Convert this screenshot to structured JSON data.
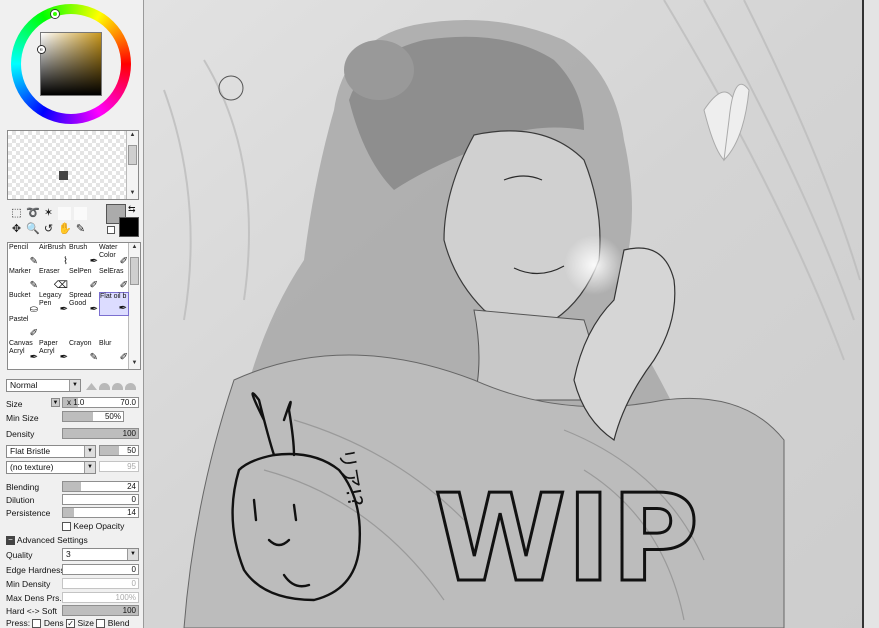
{
  "colors": {
    "accent_selection": "#7b6fd0",
    "fg_color": "#ababab",
    "bg_color": "#000000",
    "sv_hue": "#c8971d"
  },
  "brushes": [
    {
      "label": "Pencil",
      "icon": "pencil-icon"
    },
    {
      "label": "AirBrush",
      "icon": "airbrush-icon"
    },
    {
      "label": "Brush",
      "icon": "brush-icon"
    },
    {
      "label": "Water Color",
      "icon": "watercolor-icon"
    },
    {
      "label": "Marker",
      "icon": "marker-icon"
    },
    {
      "label": "Eraser",
      "icon": "eraser-icon"
    },
    {
      "label": "SelPen",
      "icon": "selpen-icon"
    },
    {
      "label": "SelEras",
      "icon": "seleras-icon"
    },
    {
      "label": "Bucket",
      "icon": "bucket-icon"
    },
    {
      "label": "Legacy Pen",
      "icon": "legacy-pen-icon"
    },
    {
      "label": "Spread Good",
      "icon": "spread-icon"
    },
    {
      "label": "Flat oil b",
      "icon": "flat-oil-icon",
      "selected": true
    },
    {
      "label": "Pastel",
      "icon": "pastel-icon"
    },
    {
      "label": "",
      "icon": ""
    },
    {
      "label": "",
      "icon": ""
    },
    {
      "label": "",
      "icon": ""
    },
    {
      "label": "Canvas Acryl",
      "icon": "canvas-acryl-icon"
    },
    {
      "label": "Paper Acryl",
      "icon": "paper-acryl-icon"
    },
    {
      "label": "Crayon",
      "icon": "crayon-icon"
    },
    {
      "label": "Blur",
      "icon": "blur-icon"
    }
  ],
  "settings": {
    "blend_mode": "Normal",
    "size_label": "Size",
    "size_mult": "x 1.0",
    "size_value": "70.0",
    "size_fraction": 0.2,
    "min_size_label": "Min Size",
    "min_size_value": "50%",
    "min_size_fraction": 0.5,
    "density_label": "Density",
    "density_value": "100",
    "density_fraction": 1.0,
    "brush_shape": "Flat Bristle",
    "brush_shape_value": "50",
    "brush_shape_fraction": 0.5,
    "texture": "(no texture)",
    "texture_value": "95",
    "blending_label": "Blending",
    "blending_value": "24",
    "blending_fraction": 0.24,
    "dilution_label": "Dilution",
    "dilution_value": "0",
    "dilution_fraction": 0,
    "persistence_label": "Persistence",
    "persistence_value": "14",
    "persistence_fraction": 0.14,
    "keep_opacity_label": "Keep Opacity",
    "advanced_label": "Advanced Settings",
    "quality_label": "Quality",
    "quality_value": "3",
    "edge_hardness_label": "Edge Hardness",
    "edge_hardness_value": "0",
    "min_density_label": "Min Density",
    "min_density_value": "0",
    "max_dens_label": "Max Dens Prs.",
    "max_dens_value": "100%",
    "hard_soft_label": "Hard <-> Soft",
    "hard_soft_value": "100",
    "hard_soft_fraction": 1.0,
    "press_label": "Press:",
    "press_dens_label": "Dens",
    "press_size_label": "Size",
    "press_blend_label": "Blend"
  },
  "canvas": {
    "wip_text": "WIP",
    "doodle_text": "リア!?"
  }
}
